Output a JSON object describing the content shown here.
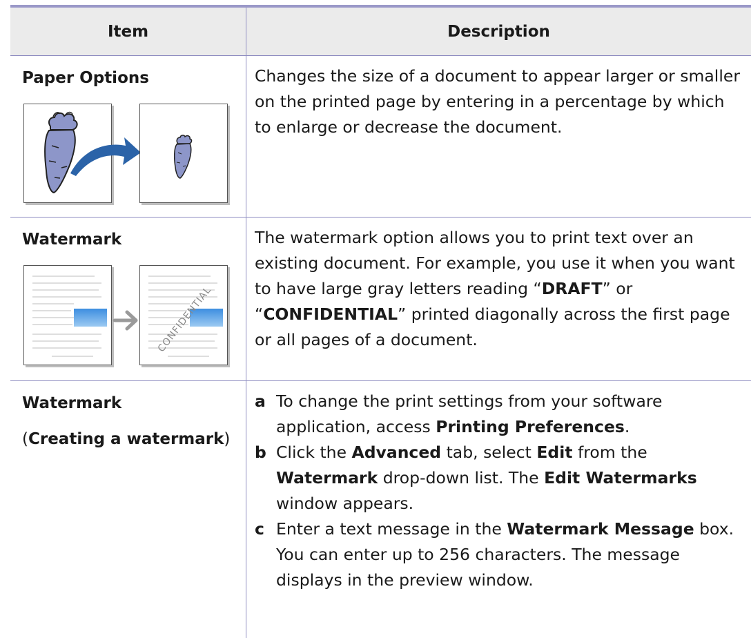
{
  "table": {
    "headers": {
      "item": "Item",
      "description": "Description"
    },
    "rows": [
      {
        "item": "Paper Options",
        "description": "Changes the size of a document to appear larger or smaller on the printed page by entering in a percentage by which to enlarge or decrease the document.",
        "illustration": "carrot-page-shrink-illustration"
      },
      {
        "item": "Watermark",
        "illustration": "watermark-preview-illustration",
        "illustration_text": "CONFIDENTIAL",
        "description_parts": [
          "The watermark option allows you to print text over an existing document. For example, you use it when you want to have large gray letters reading “",
          "DRAFT",
          "” or “",
          "CONFIDENTIAL",
          "” printed diagonally across the first page or all pages of a document."
        ]
      },
      {
        "item": "Watermark",
        "item_sub": {
          "open": "(",
          "bold": "Creating a watermark",
          "close": ")"
        },
        "steps": [
          {
            "letter": "a",
            "parts": [
              "To change the print settings from your software application, access ",
              "Printing Preferences",
              "."
            ]
          },
          {
            "letter": "b",
            "parts": [
              "Click the ",
              "Advanced",
              " tab, select ",
              "Edit",
              " from the ",
              "Watermark",
              " drop-down list. The ",
              "Edit Watermarks",
              " window appears."
            ]
          },
          {
            "letter": "c",
            "parts": [
              "Enter a text message in the ",
              "Watermark Message",
              " box. You can enter up to 256 characters. The message displays in the preview window."
            ]
          }
        ]
      }
    ]
  },
  "colors": {
    "header_background": "#ebebeb",
    "rule": "#9a98c8",
    "carrot": "#8d96c9",
    "arrow": "#2b63a8",
    "sky": "#3d8ee0"
  }
}
